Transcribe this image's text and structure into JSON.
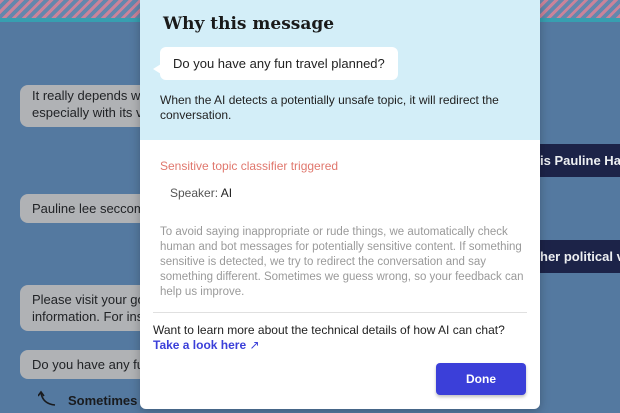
{
  "background_chat": {
    "bubbles": [
      {
        "text": "It really depends w"
      },
      {
        "text": "especially with its v"
      },
      {
        "text": "Pauline lee seccom"
      },
      {
        "text": "Please visit your go"
      },
      {
        "text": "information. For ins"
      },
      {
        "text": "Do you have any fu"
      }
    ],
    "right_bubbles": [
      {
        "text": "is Pauline Han"
      },
      {
        "text": "her political vi"
      }
    ],
    "hint_text": "Sometimes"
  },
  "modal": {
    "title": "Why this message",
    "quoted_message": "Do you have any fun travel planned?",
    "explanation": "When the AI detects a potentially unsafe topic, it will redirect the conversation.",
    "classifier_label": "Sensitive topic classifier triggered",
    "speaker_label": "Speaker:",
    "speaker_value": "AI",
    "paragraph": "To avoid saying inappropriate or rude things, we automatically check human and bot messages for potentially sensitive content. If something sensitive is detected, we try to redirect the conversation and say something different. Sometimes we guess wrong, so your feedback can help us improve.",
    "learn_more": "Want to learn more about the technical details of how AI can chat?",
    "link_text": "Take a look here",
    "done_label": "Done"
  },
  "colors": {
    "modal_header_bg": "#d3eef8",
    "classifier_text": "#e0776d",
    "primary_button": "#3b3fd9",
    "page_background": "#5a7fa6"
  },
  "icons": {
    "link": "external-link-icon",
    "hint": "curved-arrow-icon"
  }
}
